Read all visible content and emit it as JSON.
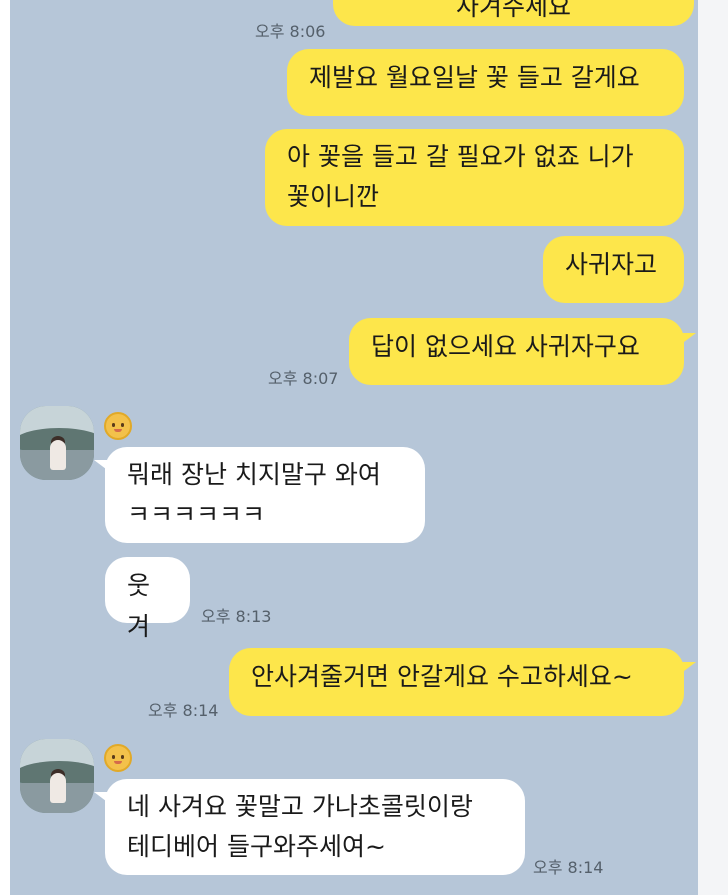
{
  "messages": [
    {
      "text": "사겨주세요",
      "time": "오후 8:06"
    },
    {
      "text": "제발요 월요일날 꽃 들고 갈게요"
    },
    {
      "text": "아 꽃을 들고 갈 필요가 없죠 니가\n꽃이니깐"
    },
    {
      "text": "사귀자고"
    },
    {
      "text": "답이 없으세요 사귀자구요",
      "time": "오후 8:07"
    },
    {
      "text": "뭐래 장난 치지말구 와여\nㅋㅋㅋㅋㅋㅋ"
    },
    {
      "text": "웃겨",
      "time": "오후 8:13"
    },
    {
      "text": "안사겨줄거면 안갈게요 수고하세요~",
      "time": "오후 8:14"
    },
    {
      "text": "네 사겨요 꽃말고 가나초콜릿이랑\n테디베어 들구와주세여~",
      "time": "오후 8:14"
    }
  ],
  "icons": {
    "avatar": "profile-photo-lake",
    "badge": "baby-face-emoji"
  },
  "colors": {
    "background": "#b6c6d8",
    "outgoing_bubble": "#fde64b",
    "incoming_bubble": "#ffffff",
    "time_text": "#55606b"
  }
}
